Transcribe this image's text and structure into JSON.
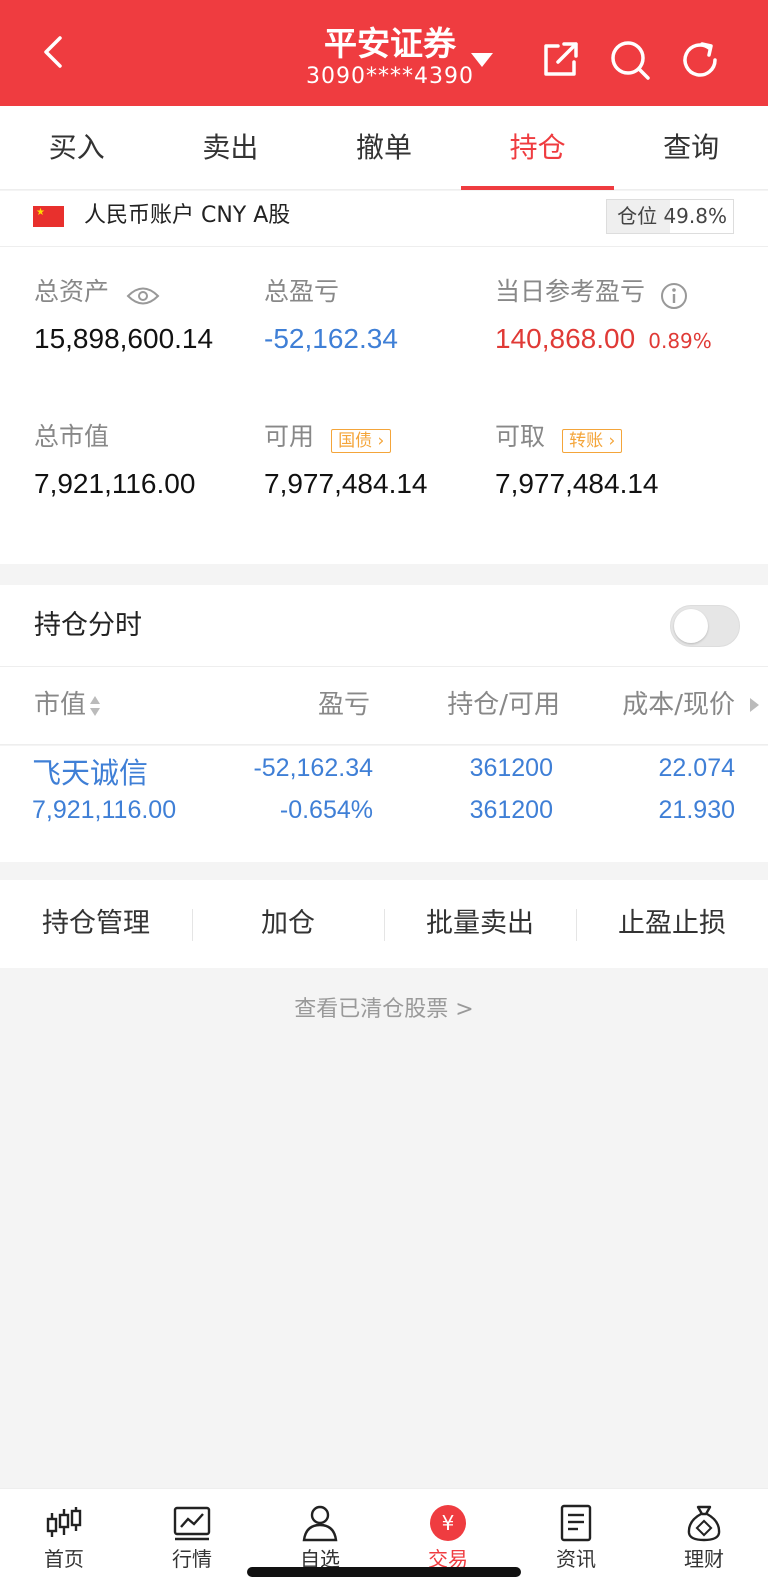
{
  "header": {
    "title": "平安证券",
    "account_masked": "3090****4390",
    "icons": [
      "back-icon",
      "dropdown-caret-icon",
      "share-icon",
      "search-icon",
      "refresh-icon"
    ]
  },
  "tabs": [
    {
      "label": "买入",
      "active": false
    },
    {
      "label": "卖出",
      "active": false
    },
    {
      "label": "撤单",
      "active": false
    },
    {
      "label": "持仓",
      "active": true
    },
    {
      "label": "查询",
      "active": false
    }
  ],
  "account": {
    "name": "人民币账户 CNY A股",
    "position_label": "仓位",
    "position_value": "49.8%",
    "position_fraction": 0.498
  },
  "summary": {
    "total_assets_label": "总资产",
    "total_assets": "15,898,600.14",
    "total_pl_label": "总盈亏",
    "total_pl": "-52,162.34",
    "daily_pl_label": "当日参考盈亏",
    "daily_pl": "140,868.00",
    "daily_pl_pct": "0.89%",
    "market_value_label": "总市值",
    "market_value": "7,921,116.00",
    "available_label": "可用",
    "available_tag": "国债",
    "available": "7,977,484.14",
    "withdrawable_label": "可取",
    "withdrawable_tag": "转账",
    "withdrawable": "7,977,484.14"
  },
  "timeshare": {
    "label": "持仓分时",
    "enabled": false
  },
  "table": {
    "headers": [
      "市值",
      "盈亏",
      "持仓/可用",
      "成本/现价"
    ],
    "rows": [
      {
        "name": "飞天诚信",
        "market_value": "7,921,116.00",
        "pl": "-52,162.34",
        "pl_pct": "-0.654%",
        "position": "361200",
        "available": "361200",
        "cost": "22.074",
        "price": "21.930"
      }
    ]
  },
  "actions": [
    "持仓管理",
    "加仓",
    "批量卖出",
    "止盈止损"
  ],
  "cleared_link": "查看已清仓股票 >",
  "bottom_nav": [
    {
      "label": "首页",
      "icon": "candlestick-icon",
      "active": false
    },
    {
      "label": "行情",
      "icon": "chart-icon",
      "active": false
    },
    {
      "label": "自选",
      "icon": "user-star-icon",
      "active": false
    },
    {
      "label": "交易",
      "icon": "yuan-icon",
      "active": true
    },
    {
      "label": "资讯",
      "icon": "document-icon",
      "active": false
    },
    {
      "label": "理财",
      "icon": "money-bag-icon",
      "active": false
    }
  ],
  "colors": {
    "brand_red": "#ef3c40",
    "gain_red": "#e03a36",
    "loss_blue": "#3f7fd6",
    "tag_orange": "#f4a53a"
  }
}
